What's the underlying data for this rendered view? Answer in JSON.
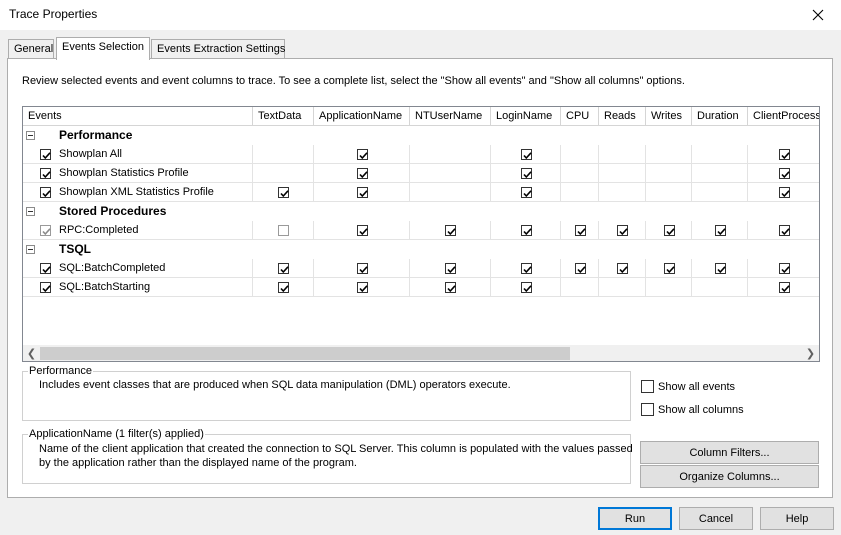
{
  "window": {
    "title": "Trace Properties"
  },
  "tabs": [
    "General",
    "Events Selection",
    "Events Extraction Settings"
  ],
  "instructions": "Review selected events and event columns to trace. To see a complete list, select the \"Show all events\" and \"Show all columns\" options.",
  "grid": {
    "columns": [
      "Events",
      "TextData",
      "ApplicationName",
      "NTUserName",
      "LoginName",
      "CPU",
      "Reads",
      "Writes",
      "Duration",
      "ClientProcessI"
    ],
    "rows": [
      {
        "type": "category",
        "label": "Performance"
      },
      {
        "type": "event",
        "label": "Showplan All",
        "selected": true,
        "cells": [
          "",
          "checked",
          "",
          "checked",
          "",
          "",
          "",
          "",
          "checked"
        ]
      },
      {
        "type": "event",
        "label": "Showplan Statistics Profile",
        "selected": true,
        "cells": [
          "",
          "checked",
          "",
          "checked",
          "",
          "",
          "",
          "",
          "checked"
        ]
      },
      {
        "type": "event",
        "label": "Showplan XML Statistics Profile",
        "selected": true,
        "cells": [
          "checked",
          "checked",
          "",
          "checked",
          "",
          "",
          "",
          "",
          "checked"
        ]
      },
      {
        "type": "category",
        "label": "Stored Procedures"
      },
      {
        "type": "event",
        "label": "RPC:Completed",
        "selected": true,
        "dim": true,
        "cells": [
          "unchecked",
          "checked",
          "checked",
          "checked",
          "checked",
          "checked",
          "checked",
          "checked",
          "checked"
        ]
      },
      {
        "type": "category",
        "label": "TSQL"
      },
      {
        "type": "event",
        "label": "SQL:BatchCompleted",
        "selected": true,
        "cells": [
          "checked",
          "checked",
          "checked",
          "checked",
          "checked",
          "checked",
          "checked",
          "checked",
          "checked"
        ]
      },
      {
        "type": "event",
        "label": "SQL:BatchStarting",
        "selected": true,
        "cells": [
          "checked",
          "checked",
          "checked",
          "checked",
          "",
          "",
          "",
          "",
          "checked"
        ]
      }
    ]
  },
  "event_description": {
    "title": "Performance",
    "text": "Includes event classes that are produced when SQL data manipulation (DML) operators execute."
  },
  "column_description": {
    "title": "ApplicationName (1 filter(s) applied)",
    "lines": [
      "Name of the client application that created the connection to SQL Server. This column is populated with the values passed",
      "by the application rather than the displayed name of the program."
    ]
  },
  "options": {
    "show_all_events": "Show all events",
    "show_all_columns": "Show all columns"
  },
  "buttons": {
    "column_filters": "Column Filters...",
    "organize_columns": "Organize Columns...",
    "run": "Run",
    "cancel": "Cancel",
    "help": "Help"
  }
}
